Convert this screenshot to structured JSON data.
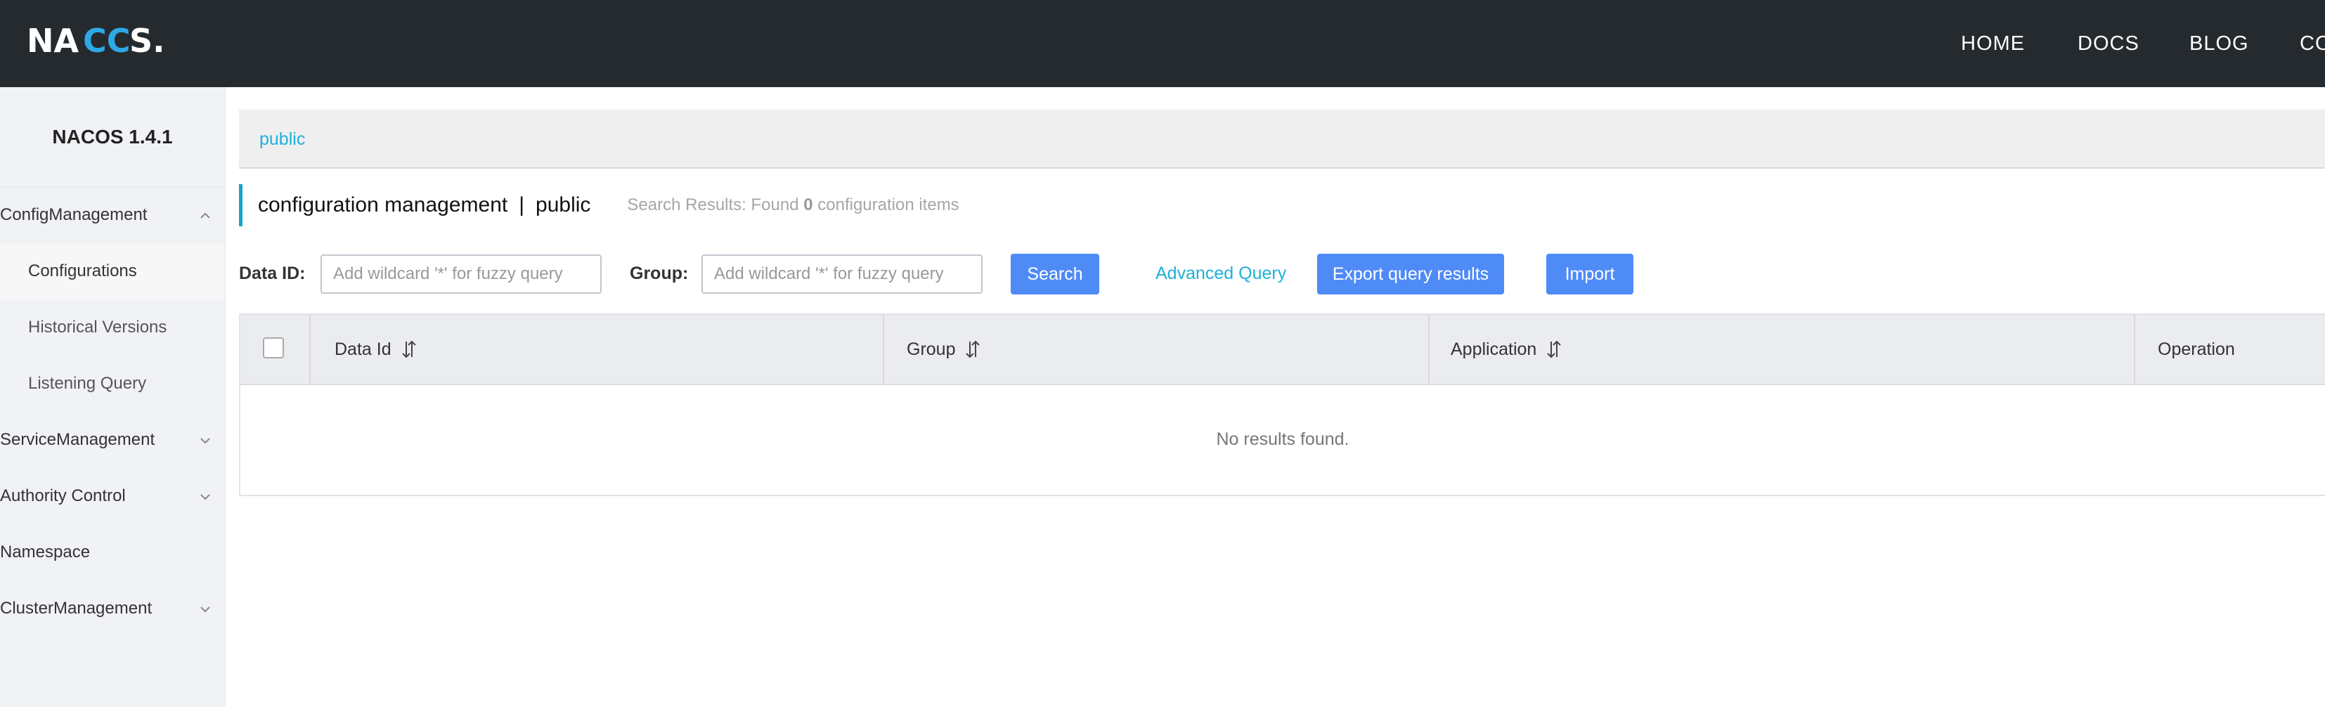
{
  "header": {
    "logo_text": "NACOS.",
    "nav": [
      "HOME",
      "DOCS",
      "BLOG",
      "CO"
    ]
  },
  "sidebar": {
    "title": "NACOS 1.4.1",
    "items": [
      {
        "label": "ConfigManagement",
        "expanded": true
      },
      {
        "label": "Configurations"
      },
      {
        "label": "Historical Versions"
      },
      {
        "label": "Listening Query"
      },
      {
        "label": "ServiceManagement",
        "expanded": false
      },
      {
        "label": "Authority Control",
        "expanded": false
      },
      {
        "label": "Namespace"
      },
      {
        "label": "ClusterManagement",
        "expanded": false
      }
    ]
  },
  "breadcrumb": {
    "namespace": "public"
  },
  "page": {
    "title": "configuration management",
    "separator": "|",
    "namespace": "public",
    "result_prefix": "Search Results: Found",
    "result_count": "0",
    "result_suffix": "configuration items"
  },
  "filters": {
    "data_id_label": "Data ID:",
    "data_id_placeholder": "Add wildcard '*' for fuzzy query",
    "group_label": "Group:",
    "group_placeholder": "Add wildcard '*' for fuzzy query",
    "search_label": "Search",
    "advanced_label": "Advanced Query",
    "export_label": "Export query results",
    "import_label": "Import"
  },
  "table": {
    "columns": [
      "Data Id",
      "Group",
      "Application",
      "Operation"
    ],
    "empty_text": "No results found."
  },
  "colors": {
    "header_bg": "#252a2f",
    "accent": "#1fb0d8",
    "button": "#4f8bf7"
  }
}
